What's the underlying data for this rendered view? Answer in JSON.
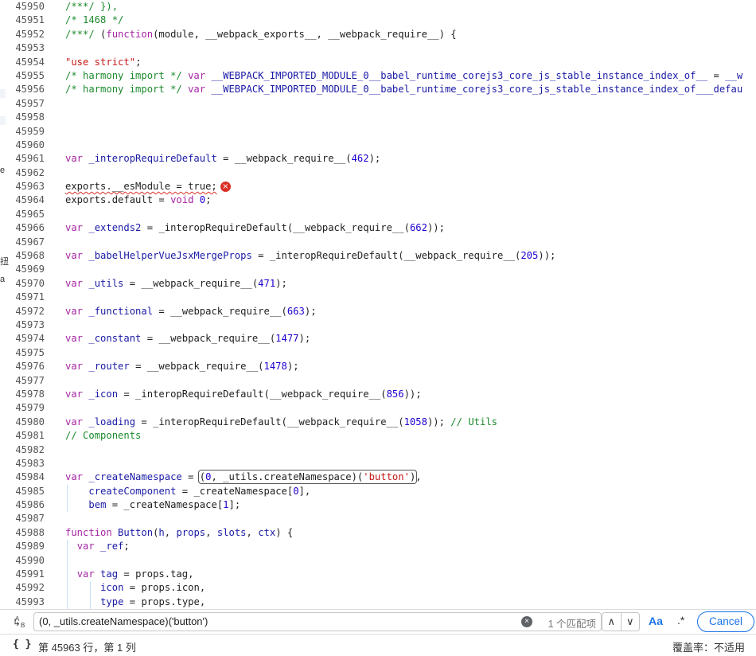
{
  "left_edge": {
    "fragments": [
      "e",
      "扭",
      "a"
    ]
  },
  "code_lines": [
    {
      "n": "45950",
      "tokens": [
        [
          "cm",
          "/***/ }),"
        ]
      ]
    },
    {
      "n": "45951",
      "tokens": [
        [
          "cm",
          "/* 1468 */"
        ]
      ]
    },
    {
      "n": "45952",
      "tokens": [
        [
          "cm",
          "/***/ "
        ],
        [
          "id",
          "("
        ],
        [
          "kw",
          "function"
        ],
        [
          "id",
          "(module, __webpack_exports__, __webpack_require__) {"
        ]
      ]
    },
    {
      "n": "45953",
      "tokens": []
    },
    {
      "n": "45954",
      "tokens": [
        [
          "str",
          "\"use strict\""
        ],
        [
          "id",
          ";"
        ]
      ]
    },
    {
      "n": "45955",
      "tokens": [
        [
          "cm",
          "/* harmony import */ "
        ],
        [
          "kw",
          "var"
        ],
        [
          "id",
          " "
        ],
        [
          "kwb",
          "__WEBPACK_IMPORTED_MODULE_0__babel_runtime_corejs3_core_js_stable_instance_index_of__"
        ],
        [
          "id",
          " = "
        ],
        [
          "kwb",
          "__w"
        ]
      ]
    },
    {
      "n": "45956",
      "tokens": [
        [
          "cm",
          "/* harmony import */ "
        ],
        [
          "kw",
          "var"
        ],
        [
          "id",
          " "
        ],
        [
          "kwb",
          "__WEBPACK_IMPORTED_MODULE_0__babel_runtime_corejs3_core_js_stable_instance_index_of___defau"
        ]
      ]
    },
    {
      "n": "45957",
      "tokens": []
    },
    {
      "n": "45958",
      "tokens": []
    },
    {
      "n": "45959",
      "tokens": []
    },
    {
      "n": "45960",
      "tokens": []
    },
    {
      "n": "45961",
      "tokens": [
        [
          "kw",
          "var"
        ],
        [
          "id",
          " "
        ],
        [
          "kwb",
          "_interopRequireDefault"
        ],
        [
          "id",
          " = __webpack_require__("
        ],
        [
          "num",
          "462"
        ],
        [
          "id",
          ");"
        ]
      ]
    },
    {
      "n": "45962",
      "tokens": []
    },
    {
      "n": "45963",
      "tokens": [
        [
          "err",
          "exports.__esModule = true;"
        ]
      ],
      "error": true
    },
    {
      "n": "45964",
      "tokens": [
        [
          "id",
          "exports.default = "
        ],
        [
          "kw",
          "void"
        ],
        [
          "id",
          " "
        ],
        [
          "num",
          "0"
        ],
        [
          "id",
          ";"
        ]
      ]
    },
    {
      "n": "45965",
      "tokens": []
    },
    {
      "n": "45966",
      "tokens": [
        [
          "kw",
          "var"
        ],
        [
          "id",
          " "
        ],
        [
          "kwb",
          "_extends2"
        ],
        [
          "id",
          " = _interopRequireDefault(__webpack_require__("
        ],
        [
          "num",
          "662"
        ],
        [
          "id",
          "));"
        ]
      ]
    },
    {
      "n": "45967",
      "tokens": []
    },
    {
      "n": "45968",
      "tokens": [
        [
          "kw",
          "var"
        ],
        [
          "id",
          " "
        ],
        [
          "kwb",
          "_babelHelperVueJsxMergeProps"
        ],
        [
          "id",
          " = _interopRequireDefault(__webpack_require__("
        ],
        [
          "num",
          "205"
        ],
        [
          "id",
          "));"
        ]
      ]
    },
    {
      "n": "45969",
      "tokens": []
    },
    {
      "n": "45970",
      "tokens": [
        [
          "kw",
          "var"
        ],
        [
          "id",
          " "
        ],
        [
          "kwb",
          "_utils"
        ],
        [
          "id",
          " = __webpack_require__("
        ],
        [
          "num",
          "471"
        ],
        [
          "id",
          ");"
        ]
      ]
    },
    {
      "n": "45971",
      "tokens": []
    },
    {
      "n": "45972",
      "tokens": [
        [
          "kw",
          "var"
        ],
        [
          "id",
          " "
        ],
        [
          "kwb",
          "_functional"
        ],
        [
          "id",
          " = __webpack_require__("
        ],
        [
          "num",
          "663"
        ],
        [
          "id",
          ");"
        ]
      ]
    },
    {
      "n": "45973",
      "tokens": []
    },
    {
      "n": "45974",
      "tokens": [
        [
          "kw",
          "var"
        ],
        [
          "id",
          " "
        ],
        [
          "kwb",
          "_constant"
        ],
        [
          "id",
          " = __webpack_require__("
        ],
        [
          "num",
          "1477"
        ],
        [
          "id",
          ");"
        ]
      ]
    },
    {
      "n": "45975",
      "tokens": []
    },
    {
      "n": "45976",
      "tokens": [
        [
          "kw",
          "var"
        ],
        [
          "id",
          " "
        ],
        [
          "kwb",
          "_router"
        ],
        [
          "id",
          " = __webpack_require__("
        ],
        [
          "num",
          "1478"
        ],
        [
          "id",
          ");"
        ]
      ]
    },
    {
      "n": "45977",
      "tokens": []
    },
    {
      "n": "45978",
      "tokens": [
        [
          "kw",
          "var"
        ],
        [
          "id",
          " "
        ],
        [
          "kwb",
          "_icon"
        ],
        [
          "id",
          " = _interopRequireDefault(__webpack_require__("
        ],
        [
          "num",
          "856"
        ],
        [
          "id",
          "));"
        ]
      ]
    },
    {
      "n": "45979",
      "tokens": []
    },
    {
      "n": "45980",
      "tokens": [
        [
          "kw",
          "var"
        ],
        [
          "id",
          " "
        ],
        [
          "kwb",
          "_loading"
        ],
        [
          "id",
          " = _interopRequireDefault(__webpack_require__("
        ],
        [
          "num",
          "1058"
        ],
        [
          "id",
          "));"
        ],
        [
          "cm",
          " // Utils"
        ]
      ]
    },
    {
      "n": "45981",
      "tokens": [
        [
          "cm",
          "// Components"
        ]
      ]
    },
    {
      "n": "45982",
      "tokens": []
    },
    {
      "n": "45983",
      "tokens": []
    },
    {
      "n": "45984",
      "tokens": [
        [
          "kw",
          "var"
        ],
        [
          "id",
          " "
        ],
        [
          "kwb",
          "_createNamespace"
        ],
        [
          "id",
          " = "
        ],
        [
          "hl_open",
          ""
        ],
        [
          "id",
          "("
        ],
        [
          "num",
          "0"
        ],
        [
          "id",
          ", _utils.createNamespace)("
        ],
        [
          "str",
          "'button'"
        ],
        [
          "id",
          ")"
        ],
        [
          "hl_close",
          ""
        ],
        [
          "id",
          ","
        ]
      ]
    },
    {
      "n": "45985",
      "indent": 1,
      "tokens": [
        [
          "kwb",
          "createComponent"
        ],
        [
          "id",
          " = _createNamespace["
        ],
        [
          "num",
          "0"
        ],
        [
          "id",
          "],"
        ]
      ]
    },
    {
      "n": "45986",
      "indent": 1,
      "tokens": [
        [
          "kwb",
          "bem"
        ],
        [
          "id",
          " = _createNamespace["
        ],
        [
          "num",
          "1"
        ],
        [
          "id",
          "];"
        ]
      ]
    },
    {
      "n": "45987",
      "tokens": []
    },
    {
      "n": "45988",
      "tokens": [
        [
          "kw",
          "function"
        ],
        [
          "id",
          " "
        ],
        [
          "kwb",
          "Button"
        ],
        [
          "id",
          "("
        ],
        [
          "kwb",
          "h"
        ],
        [
          "id",
          ", "
        ],
        [
          "kwb",
          "props"
        ],
        [
          "id",
          ", "
        ],
        [
          "kwb",
          "slots"
        ],
        [
          "id",
          ", "
        ],
        [
          "kwb",
          "ctx"
        ],
        [
          "id",
          ") {"
        ]
      ]
    },
    {
      "n": "45989",
      "indent": 0.5,
      "tokens": [
        [
          "kw",
          "var"
        ],
        [
          "id",
          " "
        ],
        [
          "kwb",
          "_ref"
        ],
        [
          "id",
          ";"
        ]
      ]
    },
    {
      "n": "45990",
      "indent": 0.5,
      "tokens": []
    },
    {
      "n": "45991",
      "indent": 0.5,
      "tokens": [
        [
          "kw",
          "var"
        ],
        [
          "id",
          " "
        ],
        [
          "kwb",
          "tag"
        ],
        [
          "id",
          " = props.tag,"
        ]
      ]
    },
    {
      "n": "45992",
      "indent": 1.5,
      "tokens": [
        [
          "kwb",
          "icon"
        ],
        [
          "id",
          " = props.icon,"
        ]
      ]
    },
    {
      "n": "45993",
      "indent": 1.5,
      "tokens": [
        [
          "kwb",
          "type"
        ],
        [
          "id",
          " = props.type,"
        ]
      ]
    }
  ],
  "search": {
    "query": "(0, _utils.createNamespace)('button')",
    "match_count": "1 个匹配项",
    "case_icon_label": "A\nB",
    "aa_label": "Aa",
    "regex_label": ".*",
    "cancel_label": "Cancel",
    "prev_label": "∧",
    "next_label": "∨",
    "clear_label": "×"
  },
  "status": {
    "braces": "{ }",
    "position": "第 45963 行，第 1 列",
    "coverage": "覆盖率：不适用"
  },
  "colors": {
    "comment": "#1c8a2d",
    "keyword": "#a626a4",
    "identifier": "#1a1aa6",
    "string": "#c41a16",
    "number": "#1c00cf",
    "accent": "#1a73e8",
    "error": "#d93025"
  }
}
